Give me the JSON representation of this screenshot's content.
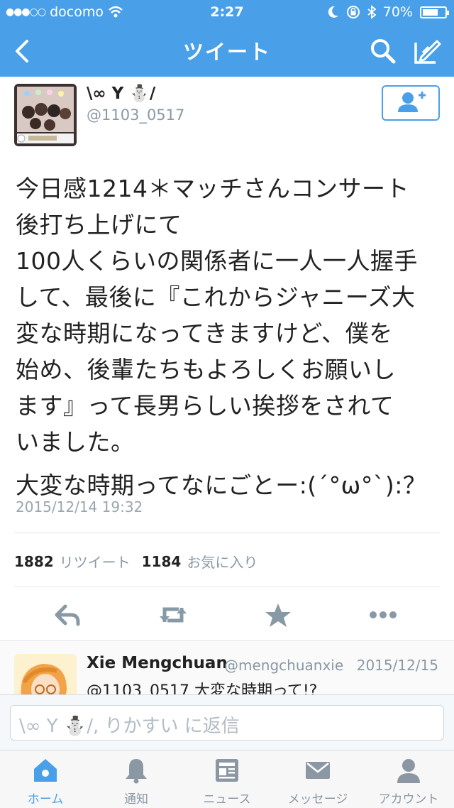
{
  "status_bar": {
    "carrier": "docomo",
    "time": "2:27",
    "battery": "70%",
    "battery_level": 0.7
  },
  "nav": {
    "title": "ツイート",
    "back_icon": "chevron-left-icon",
    "search_icon": "search-icon",
    "compose_icon": "compose-icon"
  },
  "tweet": {
    "author_name": "\\∞ Y ⛄/",
    "author_handle": "@1103_0517",
    "follow_icon": "add-user-icon",
    "text_paragraph_1": "今日感1214＊マッチさんコンサート\n後打ち上げにて\n100人くらいの関係者に一人一人握手\nして、最後に『これからジャニーズ大\n変な時期になってきますけど、僕を\n始め、後輩たちもよろしくお願いし\nます』って長男らしい挨拶をされて\nいました。",
    "text_paragraph_2": "大変な時期ってなにごとー:(´°ω°`):？",
    "date": "2015/12/14 19:32",
    "retweet_count": "1882",
    "retweet_label": "リツイート",
    "favorite_count": "1184",
    "favorite_label": "お気に入り"
  },
  "actions": [
    {
      "name": "reply-icon"
    },
    {
      "name": "retweet-icon"
    },
    {
      "name": "favorite-icon"
    },
    {
      "name": "more-icon"
    }
  ],
  "reply": {
    "author_name": "Xie Mengchuan",
    "author_handle": "@mengchuanxie",
    "date": "2015/12/15",
    "text": "@1103_0517 大変な時期って!?"
  },
  "composer": {
    "placeholder": "\\∞ Y ⛄/, りかすい に返信"
  },
  "tabs": [
    {
      "label": "ホーム",
      "icon": "home-icon",
      "active": true
    },
    {
      "label": "通知",
      "icon": "bell-icon",
      "active": false
    },
    {
      "label": "ニュース",
      "icon": "news-icon",
      "active": false
    },
    {
      "label": "メッセージ",
      "icon": "envelope-icon",
      "active": false
    },
    {
      "label": "アカウント",
      "icon": "person-icon",
      "active": false
    }
  ],
  "colors": {
    "accent": "#4aa0e8",
    "icon_gray": "#8b98a4"
  }
}
